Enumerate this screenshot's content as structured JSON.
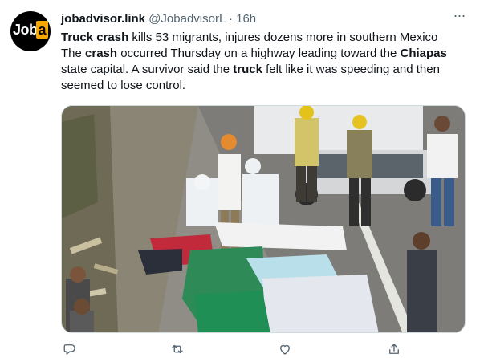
{
  "tweet": {
    "avatar_text": "Job",
    "avatar_box": "a",
    "display_name": "jobadvisor.link",
    "handle": "@JobadvisorL",
    "separator": "·",
    "timestamp": "16h",
    "more_label": "···",
    "line1": {
      "p1": "Truck",
      "p2": " ",
      "p3": "crash",
      "p4": " kills 53 migrants, injures dozens more in southern Mexico"
    },
    "line2": {
      "p1": "The ",
      "p2": "crash",
      "p3": " occurred Thursday on a highway leading toward the ",
      "p4": "Chiapas",
      "p5": " state capital. A survivor said the ",
      "p6": "truck",
      "p7": " felt like it was speeding and then seemed to lose control."
    }
  },
  "actions": {
    "reply_icon": "reply-icon",
    "retweet_icon": "retweet-icon",
    "like_icon": "heart-icon",
    "share_icon": "share-icon"
  },
  "colors": {
    "text": "#0f1419",
    "secondary": "#536471",
    "brand_box": "#f7a800"
  }
}
